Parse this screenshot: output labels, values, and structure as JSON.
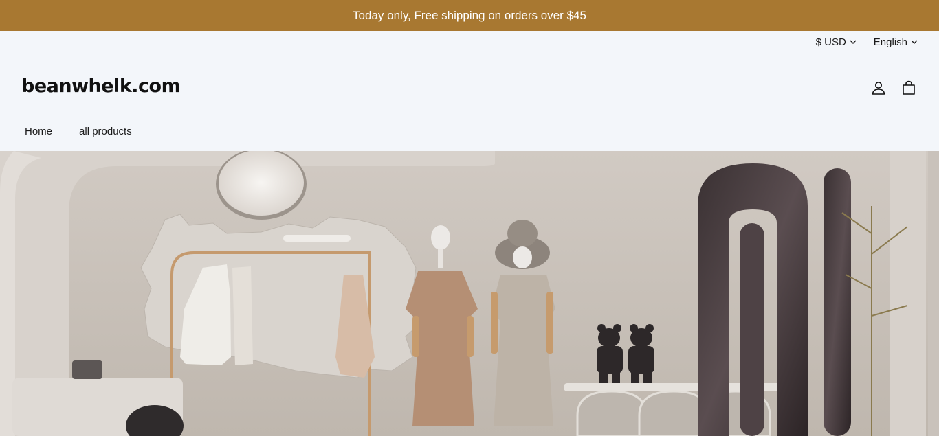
{
  "announcement": {
    "text": "Today only, Free shipping on orders over $45"
  },
  "utility": {
    "currency": "$ USD",
    "language": "English"
  },
  "header": {
    "logo": "beanwhelk.com",
    "icons": [
      "user-icon",
      "cart-icon"
    ]
  },
  "nav": {
    "items": [
      "Home",
      "all products"
    ]
  },
  "hero": {
    "description": "store-interior-image"
  },
  "colors": {
    "announcement_bg": "#a87831",
    "page_bg": "#f3f6fa"
  }
}
